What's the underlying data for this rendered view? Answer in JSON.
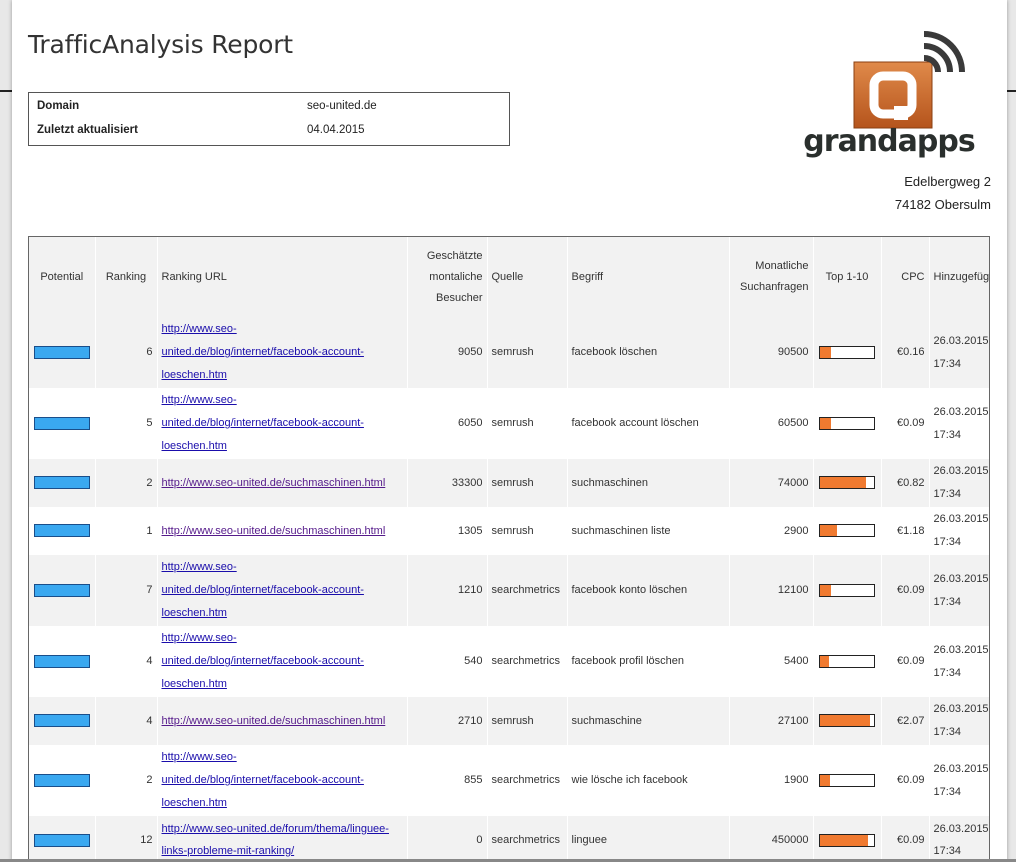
{
  "report": {
    "title": "TrafficAnalysis Report",
    "info": [
      {
        "label": "Domain",
        "value": "seo-united.de"
      },
      {
        "label": "Zuletzt aktualisiert",
        "value": "04.04.2015"
      }
    ],
    "logo_text": "grandapps",
    "address": {
      "street": "Edelbergweg 2",
      "city": "74182 Obersulm"
    }
  },
  "colors": {
    "potential_bar": "#3aa8f0",
    "top_fill": "#f07a30",
    "logo_orange": "#d2691e"
  },
  "icons": {
    "logo": "grandapps-logo-icon"
  },
  "table": {
    "headers": {
      "potential": "Potential",
      "ranking": "Ranking",
      "ranking_url": "Ranking URL",
      "visitors_l1": "Geschätzte",
      "visitors_l2": "montaliche",
      "visitors_l3": "Besucher",
      "source": "Quelle",
      "term": "Begriff",
      "searches_l1": "Monatliche",
      "searches_l2": "Suchanfragen",
      "top": "Top 1-10",
      "cpc": "CPC",
      "added": "Hinzugefügt"
    },
    "rows": [
      {
        "ranking": "6",
        "url_lines": [
          "http://www.seo-",
          "united.de/blog/internet/facebook-account-",
          "loeschen.htm"
        ],
        "visitors": "9050",
        "source": "semrush",
        "term": "facebook löschen",
        "searches": "90500",
        "top_fill": 0.2,
        "cpc": "€0.16",
        "date": "26.03.2015",
        "time": "17:34"
      },
      {
        "ranking": "5",
        "url_lines": [
          "http://www.seo-",
          "united.de/blog/internet/facebook-account-",
          "loeschen.htm"
        ],
        "visitors": "6050",
        "source": "semrush",
        "term": "facebook account löschen",
        "searches": "60500",
        "top_fill": 0.2,
        "cpc": "€0.09",
        "date": "26.03.2015",
        "time": "17:34"
      },
      {
        "ranking": "2",
        "url_lines": [
          "http://www.seo-united.de/suchmaschinen.html"
        ],
        "visitors": "33300",
        "source": "semrush",
        "term": "suchmaschinen",
        "searches": "74000",
        "top_fill": 0.85,
        "cpc": "€0.82",
        "date": "26.03.2015",
        "time": "17:34"
      },
      {
        "ranking": "1",
        "url_lines": [
          "http://www.seo-united.de/suchmaschinen.html"
        ],
        "visitors": "1305",
        "source": "semrush",
        "term": "suchmaschinen liste",
        "searches": "2900",
        "top_fill": 0.32,
        "cpc": "€1.18",
        "date": "26.03.2015",
        "time": "17:34"
      },
      {
        "ranking": "7",
        "url_lines": [
          "http://www.seo-",
          "united.de/blog/internet/facebook-account-",
          "loeschen.htm"
        ],
        "visitors": "1210",
        "source": "searchmetrics",
        "term": "facebook konto löschen",
        "searches": "12100",
        "top_fill": 0.2,
        "cpc": "€0.09",
        "date": "26.03.2015",
        "time": "17:34"
      },
      {
        "ranking": "4",
        "url_lines": [
          "http://www.seo-",
          "united.de/blog/internet/facebook-account-",
          "loeschen.htm"
        ],
        "visitors": "540",
        "source": "searchmetrics",
        "term": "facebook profil löschen",
        "searches": "5400",
        "top_fill": 0.16,
        "cpc": "€0.09",
        "date": "26.03.2015",
        "time": "17:34"
      },
      {
        "ranking": "4",
        "url_lines": [
          "http://www.seo-united.de/suchmaschinen.html"
        ],
        "visitors": "2710",
        "source": "semrush",
        "term": "suchmaschine",
        "searches": "27100",
        "top_fill": 0.92,
        "cpc": "€2.07",
        "date": "26.03.2015",
        "time": "17:34"
      },
      {
        "ranking": "2",
        "url_lines": [
          "http://www.seo-",
          "united.de/blog/internet/facebook-account-",
          "loeschen.htm"
        ],
        "visitors": "855",
        "source": "searchmetrics",
        "term": "wie lösche ich facebook",
        "searches": "1900",
        "top_fill": 0.18,
        "cpc": "€0.09",
        "date": "26.03.2015",
        "time": "17:34"
      },
      {
        "ranking": "12",
        "url_lines": [
          "http://www.seo-united.de/forum/thema/linguee-",
          "links-probleme-mit-ranking/"
        ],
        "visitors": "0",
        "source": "searchmetrics",
        "term": "linguee",
        "searches": "450000",
        "top_fill": 0.88,
        "cpc": "€0.09",
        "date": "26.03.2015",
        "time": "17:34"
      }
    ]
  }
}
